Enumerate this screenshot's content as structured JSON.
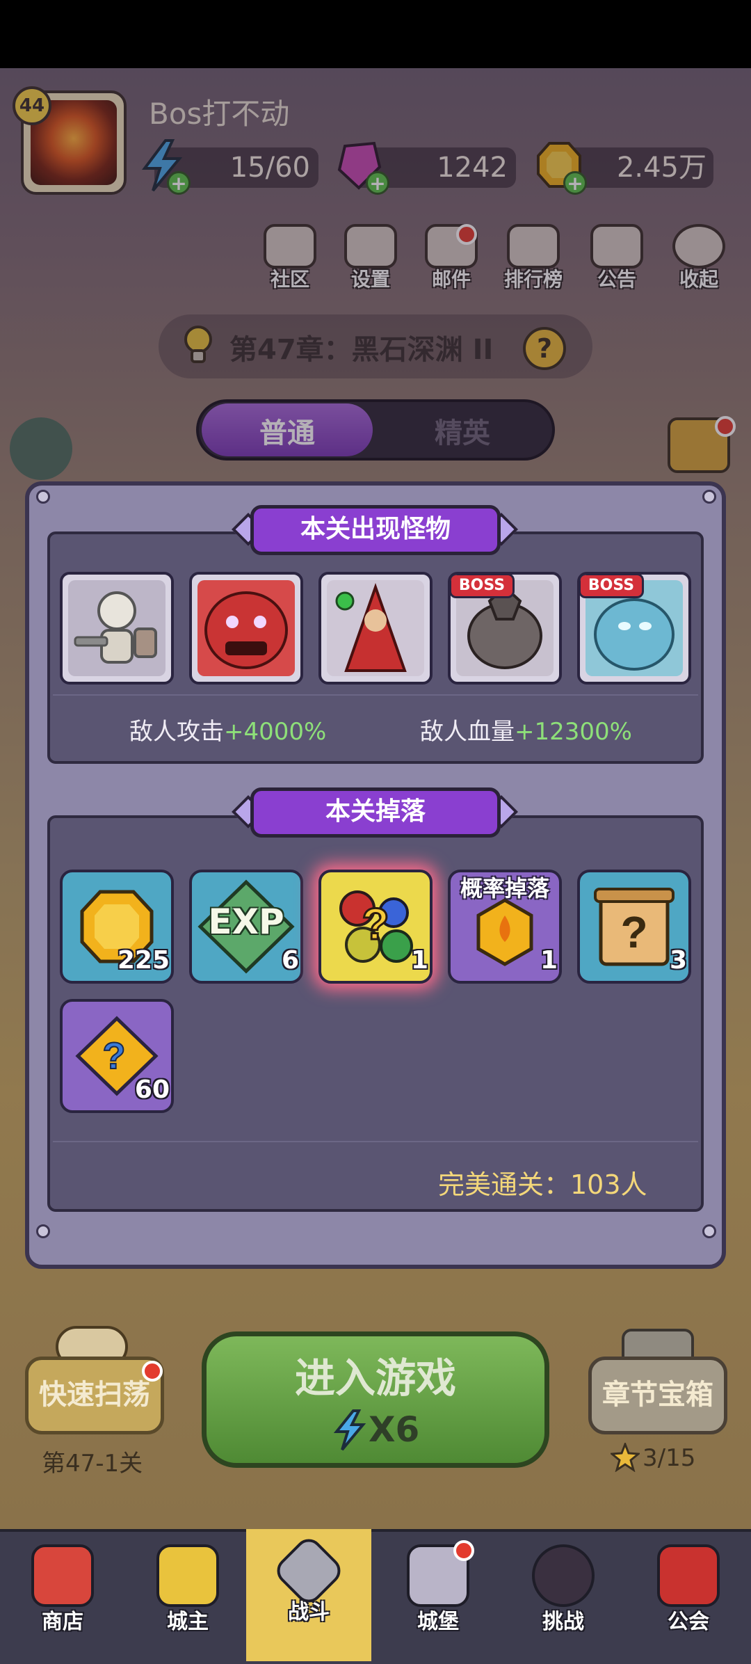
{
  "player": {
    "name": "Bos打不动",
    "level": "44"
  },
  "resources": {
    "energy": "15/60",
    "gems": "1242",
    "gold": "2.45万"
  },
  "top_menu": [
    {
      "label": "社区",
      "icon": "home-icon"
    },
    {
      "label": "设置",
      "icon": "gear-icon"
    },
    {
      "label": "邮件",
      "icon": "mail-icon"
    },
    {
      "label": "排行榜",
      "icon": "ranking-icon"
    },
    {
      "label": "公告",
      "icon": "megaphone-icon"
    },
    {
      "label": "收起",
      "icon": "play-icon"
    }
  ],
  "chapter": {
    "title": "第47章：黑石深渊 II"
  },
  "difficulty_tabs": {
    "normal": "普通",
    "elite": "精英"
  },
  "monsters_section": {
    "title": "本关出现怪物",
    "boss_badge": "BOSS",
    "enemy_attack_label": "敌人攻击",
    "enemy_attack_value": "+4000%",
    "enemy_hp_label": "敌人血量",
    "enemy_hp_value": "+12300%"
  },
  "drops_section": {
    "title": "本关掉落",
    "items": [
      {
        "icon": "gold-coin-icon",
        "count": "225"
      },
      {
        "icon": "exp-icon",
        "count": "6",
        "text": "EXP"
      },
      {
        "icon": "mystery-gems-icon",
        "count": "1"
      },
      {
        "icon": "fire-gem-icon",
        "count": "1",
        "tag": "概率掉落"
      },
      {
        "icon": "mystery-scroll-icon",
        "count": "3"
      },
      {
        "icon": "puzzle-piece-icon",
        "count": "60"
      }
    ],
    "perfect_clear": "完美通关：103人"
  },
  "actions": {
    "sweep": "快速扫荡",
    "sweep_stage": "第47-1关",
    "enter": "进入游戏",
    "enter_cost": "X6",
    "chest": "章节宝箱",
    "chest_progress": "3/15"
  },
  "nav": [
    {
      "label": "商店",
      "icon": "shop-icon"
    },
    {
      "label": "城主",
      "icon": "crown-icon"
    },
    {
      "label": "战斗",
      "icon": "swords-icon"
    },
    {
      "label": "城堡",
      "icon": "castle-icon"
    },
    {
      "label": "挑战",
      "icon": "demon-icon"
    },
    {
      "label": "公会",
      "icon": "guild-icon"
    }
  ],
  "colors": {
    "accent_purple": "#8a3fd0",
    "bonus_green": "#8ee079",
    "perfect_gold": "#f3d77a"
  }
}
